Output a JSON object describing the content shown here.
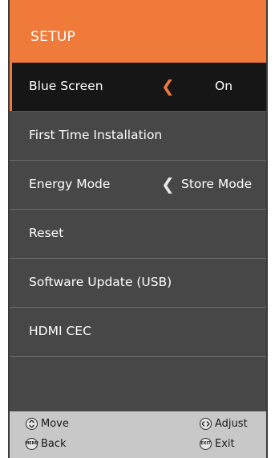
{
  "header": {
    "title": "SETUP"
  },
  "menu": {
    "items": [
      {
        "label": "Blue Screen",
        "value": "On"
      },
      {
        "label": "First Time Installation"
      },
      {
        "label": "Energy Mode",
        "value": "Store Mode"
      },
      {
        "label": "Reset"
      },
      {
        "label": "Software Update (USB)"
      },
      {
        "label": "HDMI CEC"
      }
    ]
  },
  "footer": {
    "move": {
      "icon": "up-down-nav-icon",
      "label": "Move"
    },
    "adjust": {
      "icon": "left-right-nav-icon",
      "label": "Adjust"
    },
    "back": {
      "icon": "menu-button-icon",
      "icon_text": "MENU",
      "label": "Back"
    },
    "exit": {
      "icon": "exit-button-icon",
      "icon_text": "EXIT",
      "label": "Exit"
    }
  },
  "colors": {
    "accent": "#f07a3a",
    "panel": "#474747",
    "selected_row": "#161616",
    "footer": "#c8c8c8"
  }
}
